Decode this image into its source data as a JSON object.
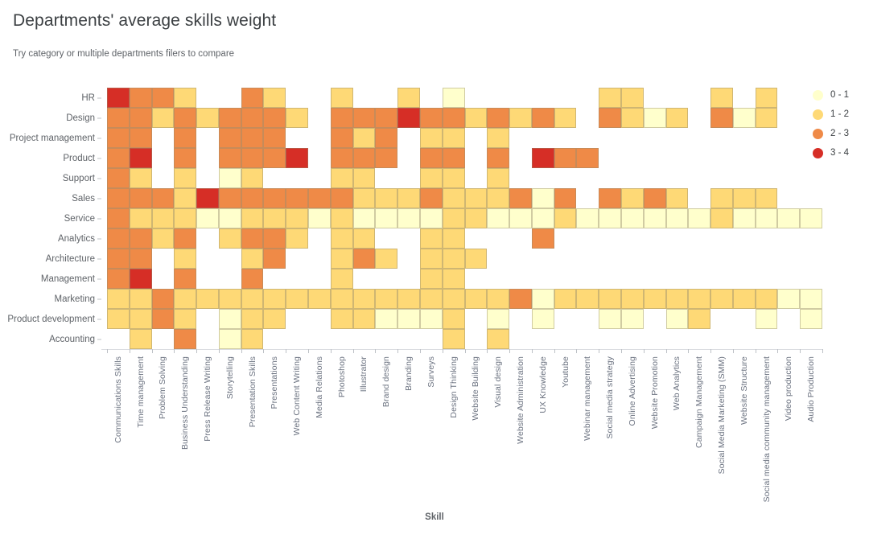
{
  "header": {
    "title": "Departments' average skills weight",
    "subtitle": "Try category or multiple departments filers to compare"
  },
  "axis": {
    "x_title": "Skill"
  },
  "legend": {
    "entries": [
      {
        "label": "0 - 1",
        "color": "#ffffcc"
      },
      {
        "label": "1 - 2",
        "color": "#fed976"
      },
      {
        "label": "2 - 3",
        "color": "#ef8a47"
      },
      {
        "label": "3 - 4",
        "color": "#d62e26"
      }
    ]
  },
  "chart_data": {
    "type": "heatmap",
    "title": "Departments' average skills weight",
    "subtitle": "Try category or multiple departments filers to compare",
    "xlabel": "Skill",
    "ylabel": "",
    "colorscale": [
      {
        "range": "0 - 1",
        "color": "#ffffcc"
      },
      {
        "range": "1 - 2",
        "color": "#fed976"
      },
      {
        "range": "2 - 3",
        "color": "#ef8a47"
      },
      {
        "range": "3 - 4",
        "color": "#d62e26"
      }
    ],
    "legend_position": "right",
    "grid": true,
    "rows": [
      "HR",
      "Design",
      "Project management",
      "Product",
      "Support",
      "Sales",
      "Service",
      "Analytics",
      "Architecture",
      "Management",
      "Marketing",
      "Product development",
      "Accounting"
    ],
    "columns": [
      "Communications Skills",
      "Time management",
      "Problem Solving",
      "Business Understanding",
      "Press Release Writing",
      "Storytelling",
      "Presentation Skills",
      "Presentations",
      "Web Content Writing",
      "Media Relations",
      "Photoshop",
      "Illustrator",
      "Brand design",
      "Branding",
      "Surveys",
      "Design Thinking",
      "Website Building",
      "Visual design",
      "Website Administration",
      "UX Knowledge",
      "Youtube",
      "Webinar management",
      "Social media strategy",
      "Online Advertising",
      "Website Promotion",
      "Web Analytics",
      "Campaign Management",
      "Social Media Marketing (SMM)",
      "Website Structure",
      "Social media community management",
      "Video production",
      "Audio Production"
    ],
    "values": [
      [
        3.5,
        2.5,
        2.5,
        1.5,
        null,
        null,
        2.5,
        1.5,
        null,
        null,
        1.5,
        null,
        null,
        1.5,
        null,
        0.5,
        null,
        null,
        null,
        null,
        null,
        null,
        1.5,
        1.5,
        null,
        null,
        null,
        1.5,
        null,
        1.5,
        null,
        null
      ],
      [
        2.5,
        2.5,
        1.5,
        2.5,
        1.5,
        2.5,
        2.5,
        2.5,
        1.5,
        null,
        2.5,
        2.5,
        2.5,
        3.5,
        2.5,
        2.5,
        1.5,
        2.5,
        1.5,
        2.5,
        1.5,
        null,
        2.5,
        1.5,
        0.5,
        1.5,
        null,
        2.5,
        0.5,
        1.5,
        null,
        null
      ],
      [
        2.5,
        2.5,
        null,
        2.5,
        null,
        2.5,
        2.5,
        2.5,
        null,
        null,
        2.5,
        1.5,
        2.5,
        null,
        1.5,
        1.5,
        null,
        1.5,
        null,
        null,
        null,
        null,
        null,
        null,
        null,
        null,
        null,
        null,
        null,
        null,
        null,
        null
      ],
      [
        2.5,
        3.5,
        null,
        2.5,
        null,
        2.5,
        2.5,
        2.5,
        3.5,
        null,
        2.5,
        2.5,
        2.5,
        null,
        2.5,
        2.5,
        null,
        2.5,
        null,
        3.5,
        2.5,
        2.5,
        null,
        null,
        null,
        null,
        null,
        null,
        null,
        null,
        null,
        null
      ],
      [
        2.5,
        1.5,
        null,
        1.5,
        null,
        0.5,
        1.5,
        null,
        null,
        null,
        1.5,
        1.5,
        null,
        null,
        1.5,
        1.5,
        null,
        1.5,
        null,
        null,
        null,
        null,
        null,
        null,
        null,
        null,
        null,
        null,
        null,
        null,
        null,
        null
      ],
      [
        2.5,
        2.5,
        2.5,
        1.5,
        3.5,
        2.5,
        2.5,
        2.5,
        2.5,
        2.5,
        2.5,
        1.5,
        1.5,
        1.5,
        2.5,
        1.5,
        1.5,
        1.5,
        2.5,
        0.5,
        2.5,
        null,
        2.5,
        1.5,
        2.5,
        1.5,
        null,
        1.5,
        1.5,
        1.5,
        null,
        null
      ],
      [
        2.5,
        1.5,
        1.5,
        1.5,
        0.5,
        0.5,
        1.5,
        1.5,
        1.5,
        0.5,
        1.5,
        0.5,
        0.5,
        0.5,
        0.5,
        1.5,
        1.5,
        0.5,
        0.5,
        0.5,
        1.5,
        0.5,
        0.5,
        0.5,
        0.5,
        0.5,
        0.5,
        1.5,
        0.5,
        0.5,
        0.5,
        0.5
      ],
      [
        2.5,
        2.5,
        1.5,
        2.5,
        null,
        1.5,
        2.5,
        2.5,
        1.5,
        null,
        1.5,
        1.5,
        null,
        null,
        1.5,
        1.5,
        null,
        null,
        null,
        2.5,
        null,
        null,
        null,
        null,
        null,
        null,
        null,
        null,
        null,
        null,
        null,
        null
      ],
      [
        2.5,
        2.5,
        null,
        1.5,
        null,
        null,
        1.5,
        2.5,
        null,
        null,
        1.5,
        2.5,
        1.5,
        null,
        1.5,
        1.5,
        1.5,
        null,
        null,
        null,
        null,
        null,
        null,
        null,
        null,
        null,
        null,
        null,
        null,
        null,
        null,
        null
      ],
      [
        2.5,
        3.5,
        null,
        2.5,
        null,
        null,
        2.5,
        null,
        null,
        null,
        1.5,
        null,
        null,
        null,
        1.5,
        1.5,
        null,
        null,
        null,
        null,
        null,
        null,
        null,
        null,
        null,
        null,
        null,
        null,
        null,
        null,
        null,
        null
      ],
      [
        1.5,
        1.5,
        2.5,
        1.5,
        1.5,
        1.5,
        1.5,
        1.5,
        1.5,
        1.5,
        1.5,
        1.5,
        1.5,
        1.5,
        1.5,
        1.5,
        1.5,
        1.5,
        2.5,
        0.5,
        1.5,
        1.5,
        1.5,
        1.5,
        1.5,
        1.5,
        1.5,
        1.5,
        1.5,
        1.5,
        0.5,
        0.5
      ],
      [
        1.5,
        1.5,
        2.5,
        1.5,
        null,
        0.5,
        1.5,
        1.5,
        null,
        null,
        1.5,
        1.5,
        0.5,
        0.5,
        0.5,
        1.5,
        null,
        0.5,
        null,
        0.5,
        null,
        null,
        0.5,
        0.5,
        null,
        0.5,
        1.5,
        null,
        null,
        0.5,
        null,
        0.5
      ],
      [
        null,
        1.5,
        null,
        2.5,
        null,
        0.5,
        1.5,
        null,
        null,
        null,
        null,
        null,
        null,
        null,
        null,
        1.5,
        null,
        1.5,
        null,
        null,
        null,
        null,
        null,
        null,
        null,
        null,
        null,
        null,
        null,
        null,
        null,
        null
      ]
    ]
  }
}
